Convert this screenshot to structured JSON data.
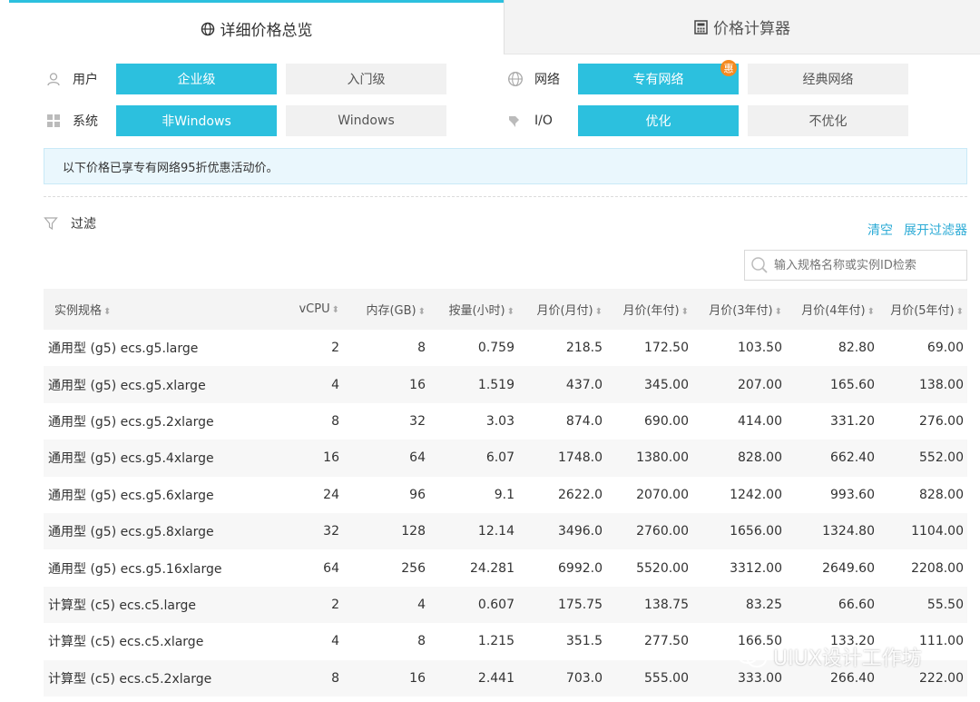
{
  "tabs": [
    {
      "label": "详细价格总览",
      "active": true,
      "icon": "globe-icon"
    },
    {
      "label": "价格计算器",
      "active": false,
      "icon": "calculator-icon"
    }
  ],
  "options": {
    "user": {
      "label": "用户",
      "icon": "user-icon",
      "choices": [
        "企业级",
        "入门级"
      ],
      "selected": "企业级"
    },
    "network": {
      "label": "网络",
      "icon": "globe-icon",
      "choices": [
        "专有网络",
        "经典网络"
      ],
      "selected": "专有网络",
      "badge": "惠"
    },
    "system": {
      "label": "系统",
      "icon": "windows-grid-icon",
      "choices": [
        "非Windows",
        "Windows"
      ],
      "selected": "非Windows"
    },
    "io": {
      "label": "I/O",
      "icon": "pin-icon",
      "choices": [
        "优化",
        "不优化"
      ],
      "selected": "优化"
    }
  },
  "notice": "以下价格已享专有网络95折优惠活动价。",
  "filter": {
    "label": "过滤",
    "icon": "funnel-icon",
    "clear_label": "清空",
    "expand_label": "展开过滤器"
  },
  "search": {
    "placeholder": "输入规格名称或实例ID检索",
    "icon": "search-icon"
  },
  "table": {
    "headers": [
      "实例规格",
      "vCPU",
      "内存(GB)",
      "按量(小时)",
      "月价(月付)",
      "月价(年付)",
      "月价(3年付)",
      "月价(4年付)",
      "月价(5年付)"
    ],
    "rows": [
      [
        "通用型 (g5) ecs.g5.large",
        "2",
        "8",
        "0.759",
        "218.5",
        "172.50",
        "103.50",
        "82.80",
        "69.00"
      ],
      [
        "通用型 (g5) ecs.g5.xlarge",
        "4",
        "16",
        "1.519",
        "437.0",
        "345.00",
        "207.00",
        "165.60",
        "138.00"
      ],
      [
        "通用型 (g5) ecs.g5.2xlarge",
        "8",
        "32",
        "3.03",
        "874.0",
        "690.00",
        "414.00",
        "331.20",
        "276.00"
      ],
      [
        "通用型 (g5) ecs.g5.4xlarge",
        "16",
        "64",
        "6.07",
        "1748.0",
        "1380.00",
        "828.00",
        "662.40",
        "552.00"
      ],
      [
        "通用型 (g5) ecs.g5.6xlarge",
        "24",
        "96",
        "9.1",
        "2622.0",
        "2070.00",
        "1242.00",
        "993.60",
        "828.00"
      ],
      [
        "通用型 (g5) ecs.g5.8xlarge",
        "32",
        "128",
        "12.14",
        "3496.0",
        "2760.00",
        "1656.00",
        "1324.80",
        "1104.00"
      ],
      [
        "通用型 (g5) ecs.g5.16xlarge",
        "64",
        "256",
        "24.281",
        "6992.0",
        "5520.00",
        "3312.00",
        "2649.60",
        "2208.00"
      ],
      [
        "计算型 (c5) ecs.c5.large",
        "2",
        "4",
        "0.607",
        "175.75",
        "138.75",
        "83.25",
        "66.60",
        "55.50"
      ],
      [
        "计算型 (c5) ecs.c5.xlarge",
        "4",
        "8",
        "1.215",
        "351.5",
        "277.50",
        "166.50",
        "133.20",
        "111.00"
      ],
      [
        "计算型 (c5) ecs.c5.2xlarge",
        "8",
        "16",
        "2.441",
        "703.0",
        "555.00",
        "333.00",
        "266.40",
        "222.00"
      ]
    ]
  },
  "watermark": {
    "text": "UIUX设计工作坊",
    "icon": "wechat-icon"
  },
  "colors": {
    "accent": "#2cc0de",
    "link": "#2cabd6",
    "badge": "#f58a1f",
    "notice_bg": "#eaf7fd"
  }
}
